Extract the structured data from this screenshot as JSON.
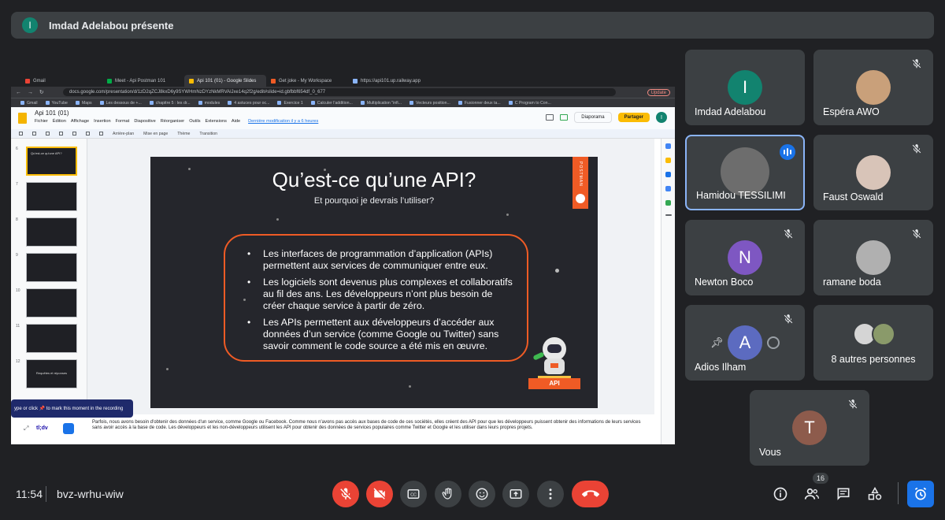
{
  "presenter": {
    "initial": "I",
    "text": "Imdad Adelabou présente"
  },
  "browser": {
    "tabs": [
      "Gmail",
      "Meet - Api Postman 101",
      "Api 101 (01) - Google Slides",
      "Get joke - My Workspace",
      "https://api101.up.railway.app"
    ],
    "url": "docs.google.com/presentation/d/1zD2qZCJ8kxD6y9SYWHmNzDYzNkMRVAlJxe14q2f2g/edit#slide=id.gbfbbf654df_0_677",
    "update_label": "Update",
    "bookmarks": [
      "Gmail",
      "YouTube",
      "Maps",
      "Les dessous de +...",
      "chapitre 5 : les dr...",
      "modules",
      "4 astuces pour oc...",
      "Exercice 1",
      "Calculer l'addition...",
      "Multiplication \"infi...",
      "Vecteurs position...",
      "Fusionner deux ta...",
      "C Program to Con..."
    ]
  },
  "docs": {
    "title": "Api 101 (01)",
    "menu": [
      "Fichier",
      "Édition",
      "Affichage",
      "Insertion",
      "Format",
      "Diapositive",
      "Réorganiser",
      "Outils",
      "Extensions",
      "Aide"
    ],
    "last_edit": "Dernière modification il y a 6 heures",
    "diaporama_label": "Diaporama",
    "share_label": "Partager",
    "user_initial": "I",
    "toolbar": [
      "Arrière-plan",
      "Mise en page",
      "Thème",
      "Transition"
    ]
  },
  "filmstrip": [
    {
      "num": "6",
      "text": "Qu'est-ce qu'une API?",
      "active": true
    },
    {
      "num": "7",
      "text": "",
      "active": false
    },
    {
      "num": "8",
      "text": "",
      "active": false
    },
    {
      "num": "9",
      "text": "",
      "active": false
    },
    {
      "num": "10",
      "text": "",
      "active": false
    },
    {
      "num": "11",
      "text": "",
      "active": false
    },
    {
      "num": "12",
      "text": "Requêtes et réponses",
      "active": false
    }
  ],
  "slide": {
    "title": "Qu’est-ce qu’une API?",
    "subtitle": "Et pourquoi je devrais l’utiliser?",
    "bullets": [
      "Les interfaces de programmation d’application (APIs) permettent aux services de communiquer entre eux.",
      "Les logiciels sont devenus plus complexes et collaboratifs au fil des ans. Les développeurs n’ont plus besoin de créer chaque service à partir de zéro.",
      "Les APIs permettent aux développeurs d’accéder aux données d’un service (comme Google ou Twitter) sans savoir comment le code source a été mis en œuvre."
    ],
    "brand_tab": "POSTMAN",
    "api_sign": "API"
  },
  "notes": "Parfois, nous avons besoin d'obtenir des données d'un service, comme Google ou Facebook. Comme nous n'avons pas accès aux bases de code de ces sociétés, elles créent des API pour que les développeurs puissent obtenir des informations de leurs services sans avoir accès à la base de code. Les développeurs et les non-développeurs utilisent les API pour obtenir des données de services populaires comme Twitter et Google et les utiliser dans leurs propres projets.",
  "recording_tip": "ype or click 📌 to mark this moment in the recording",
  "tldv_label": "tl;dv",
  "participants": [
    {
      "name": "Imdad Adelabou",
      "initial": "I",
      "color": "#12836f",
      "muted": false,
      "speaking": false
    },
    {
      "name": "Espéra AWO",
      "initial": "",
      "color": "#c9a07a",
      "muted": true,
      "speaking": false
    },
    {
      "name": "Hamidou TESSILIMI",
      "initial": "",
      "color": "#6d6d6d",
      "muted": false,
      "speaking": true
    },
    {
      "name": "Faust Oswald",
      "initial": "",
      "color": "#d8c4b8",
      "muted": true,
      "speaking": false
    },
    {
      "name": "Newton Boco",
      "initial": "N",
      "color": "#7e57c2",
      "muted": true,
      "speaking": false
    },
    {
      "name": "ramane boda",
      "initial": "",
      "color": "#b0b0b0",
      "muted": true,
      "speaking": false
    },
    {
      "name": "Adios Ilham",
      "initial": "A",
      "color": "#5c6bc0",
      "muted": true,
      "speaking": false
    },
    {
      "name": "8 autres personnes",
      "initial": "",
      "color": "",
      "muted": false,
      "speaking": false
    },
    {
      "name": "Vous",
      "initial": "T",
      "color": "#8d5b4c",
      "muted": true,
      "speaking": false
    }
  ],
  "bottom": {
    "time": "11:54",
    "meeting_code": "bvz-wrhu-wiw",
    "people_count": "16"
  }
}
